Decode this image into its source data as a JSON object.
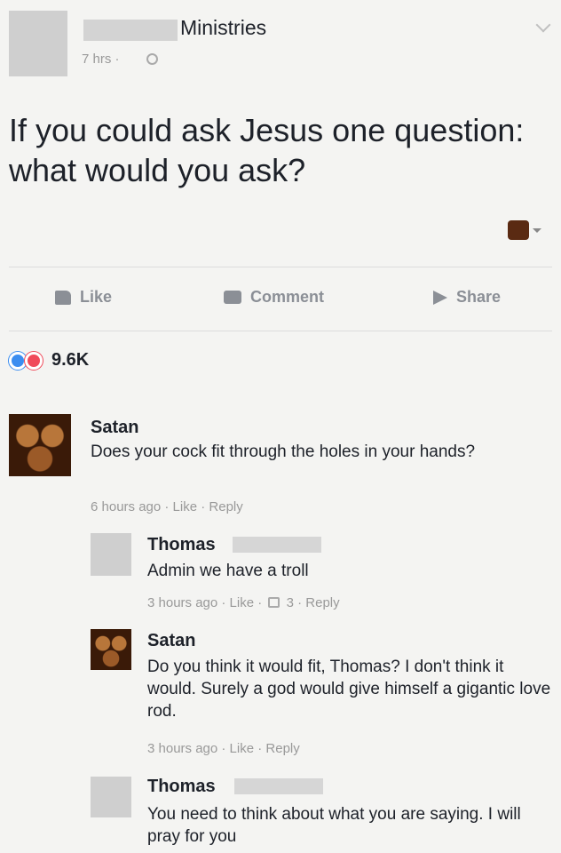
{
  "post": {
    "page_name": "Ministries",
    "time": "7 hrs ·",
    "text": "If you could ask Jesus one question: what would you ask?"
  },
  "actions": {
    "like": "Like",
    "comment": "Comment",
    "share": "Share"
  },
  "reactions": {
    "count": "9.6K"
  },
  "comments": [
    {
      "name": "Satan",
      "text": "Does your cock fit through the holes in your hands?",
      "meta": "6 hours ago · Like · Reply"
    },
    {
      "name": "Thomas",
      "text": "Admin we have a troll",
      "meta_prefix": "3 hours ago · Like ·",
      "meta_suffix": "3 · Reply"
    },
    {
      "name": "Satan",
      "text": "Do you think it would fit, Thomas? I don't think it would. Surely a god would give himself a gigantic love rod.",
      "meta": "3 hours ago · Like · Reply"
    },
    {
      "name": "Thomas",
      "text": "You need to think about what you are saying. I will pray for you"
    }
  ],
  "colors": {
    "text": "#1d2129",
    "muted": "#999999",
    "action_grey": "#8b8f96",
    "like_blue": "#3b8df0",
    "love_red": "#f04a5a"
  },
  "icons": [
    "globe-icon",
    "chevron-down-icon",
    "like-icon",
    "comment-icon",
    "share-icon",
    "reaction-like-icon",
    "reaction-love-icon",
    "thumb-icon"
  ]
}
